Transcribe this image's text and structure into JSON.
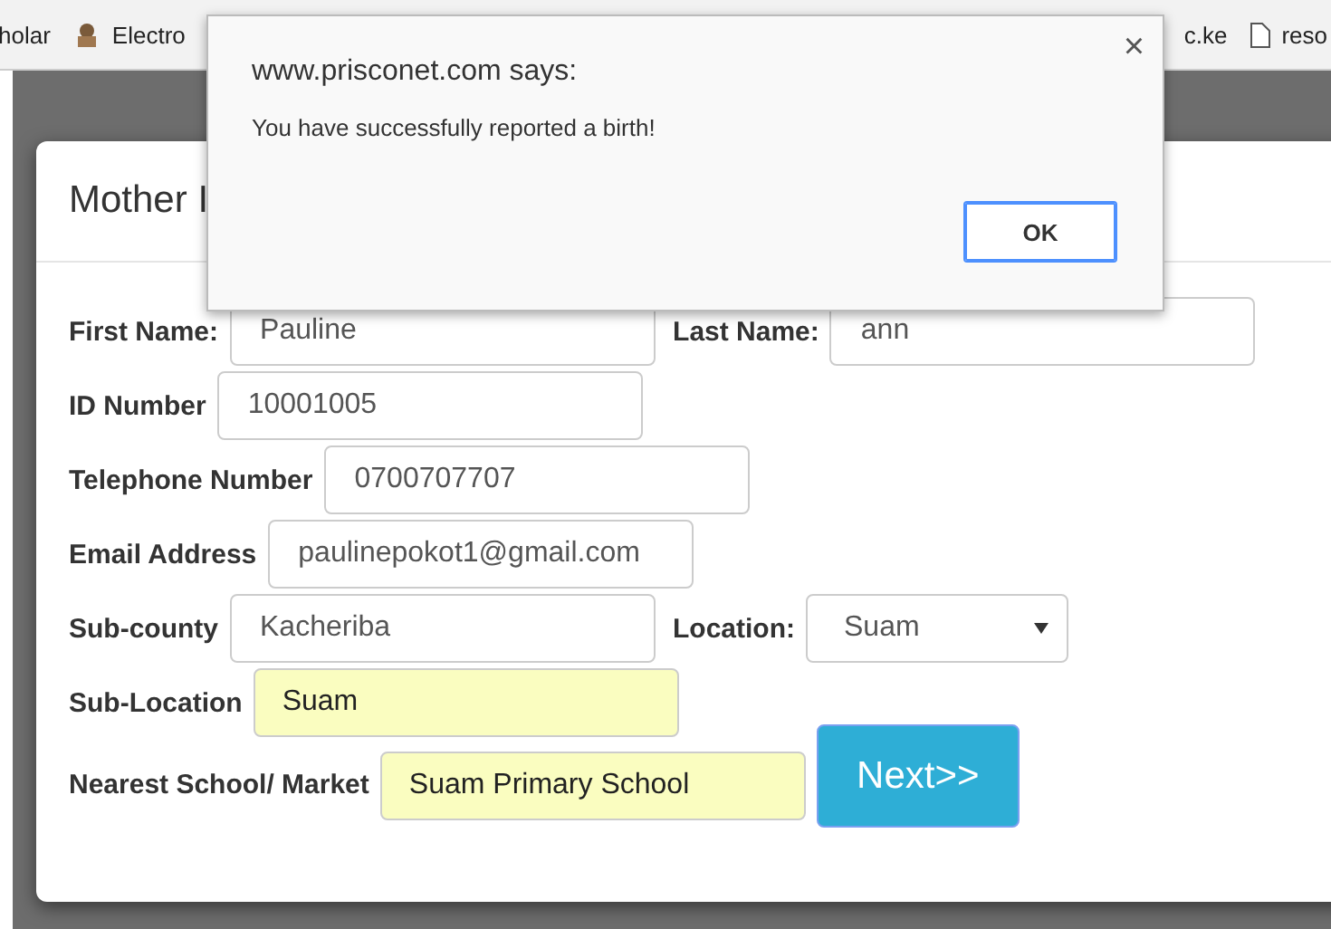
{
  "bookmarks_bar": {
    "left": [
      {
        "label": "holar",
        "kind": "plain"
      },
      {
        "label": "Electro",
        "kind": "crest"
      }
    ],
    "right": [
      {
        "label": "c.ke",
        "kind": "plain"
      },
      {
        "label": "reso",
        "kind": "page"
      }
    ]
  },
  "modal": {
    "title": "Mother I",
    "rows": [
      {
        "fields": [
          {
            "label": "First Name:",
            "value": "Pauline",
            "kind": "text",
            "autofilled": false
          },
          {
            "label": "Last Name:",
            "value": "ann",
            "kind": "text",
            "autofilled": false
          }
        ]
      },
      {
        "fields": [
          {
            "label": "ID Number",
            "value": "10001005",
            "kind": "text",
            "autofilled": false
          }
        ]
      },
      {
        "fields": [
          {
            "label": "Telephone Number",
            "value": "0700707707",
            "kind": "text",
            "autofilled": false
          }
        ]
      },
      {
        "fields": [
          {
            "label": "Email Address",
            "value": "paulinepokot1@gmail.com",
            "kind": "text",
            "autofilled": false
          }
        ]
      },
      {
        "fields": [
          {
            "label": "Sub-county",
            "value": "Kacheriba",
            "kind": "text",
            "autofilled": false
          },
          {
            "label": "Location:",
            "value": "Suam",
            "kind": "select",
            "autofilled": false
          }
        ]
      },
      {
        "fields": [
          {
            "label": "Sub-Location",
            "value": "Suam",
            "kind": "text",
            "autofilled": true
          }
        ]
      },
      {
        "fields": [
          {
            "label": "Nearest School/ Market",
            "value": "Suam Primary School",
            "kind": "text",
            "autofilled": true
          }
        ],
        "button": "Next>>"
      }
    ]
  },
  "alert": {
    "title": "www.prisconet.com says:",
    "message": "You have successfully reported a birth!",
    "close": "×",
    "button": "OK"
  }
}
